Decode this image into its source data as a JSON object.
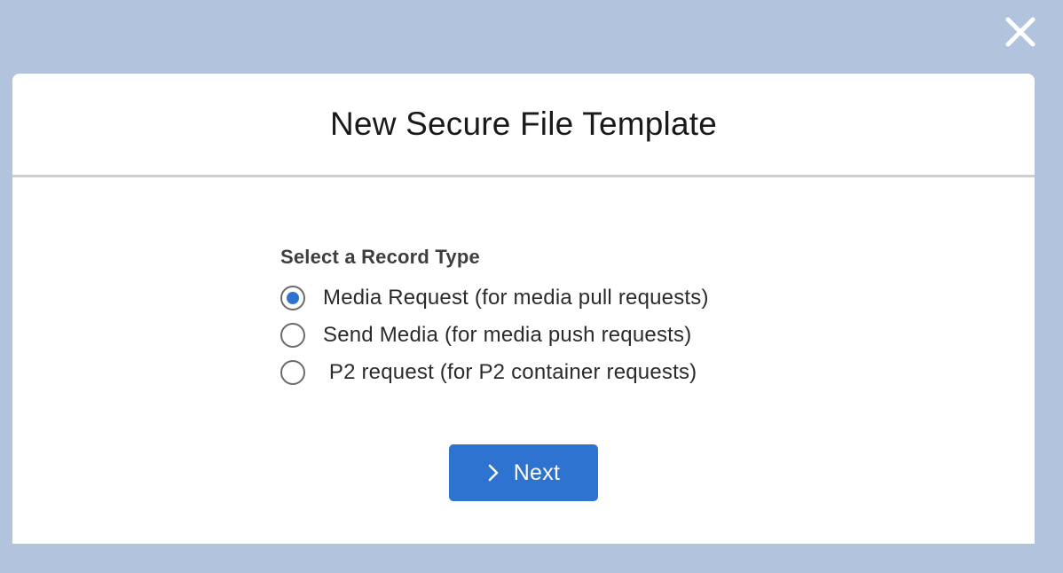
{
  "modal": {
    "title": "New Secure File Template"
  },
  "record_type": {
    "label": "Select a Record Type",
    "options": [
      {
        "label": "Media Request (for media pull requests)",
        "selected": true
      },
      {
        "label": "Send Media (for media push requests)",
        "selected": false
      },
      {
        "label": " P2 request (for P2 container requests)",
        "selected": false
      }
    ]
  },
  "buttons": {
    "next_label": "Next",
    "next_icon": "chevron-right-icon",
    "close_icon": "close-icon"
  },
  "colors": {
    "overlay_background": "#b1c3dd",
    "accent": "#2f73d0",
    "radio_border": "#6b6b6b"
  }
}
